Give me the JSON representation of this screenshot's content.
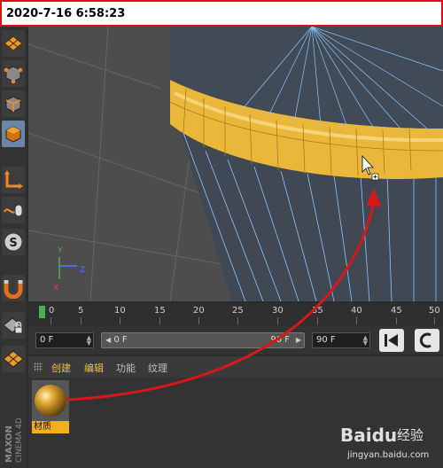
{
  "timestamp": "2020-7-16 6:58:23",
  "viewport": {
    "axis_x": "X",
    "axis_y": "Y",
    "axis_z": "Z"
  },
  "timeline": {
    "ticks": [
      "0",
      "5",
      "10",
      "15",
      "20",
      "25",
      "30",
      "35",
      "40",
      "45",
      "50"
    ]
  },
  "controls": {
    "start_frame": "0 F",
    "range_start": "0 F",
    "range_end": "90 F",
    "end_frame": "90 F"
  },
  "material_menu": {
    "create": "创建",
    "edit": "编辑",
    "function": "功能",
    "texture": "纹理"
  },
  "material": {
    "name": "材质"
  },
  "branding": {
    "maxon": "MAXON",
    "cinema": "CINEMA 4D"
  },
  "watermark": {
    "logo": "Baidu",
    "jingyan": "经验",
    "url": "jingyan.baidu.com"
  },
  "colors": {
    "highlight_red": "#e01010",
    "selected_face": "#e9b83a",
    "mesh_edge": "#8ec6ff",
    "accent_orange": "#f0b020"
  }
}
